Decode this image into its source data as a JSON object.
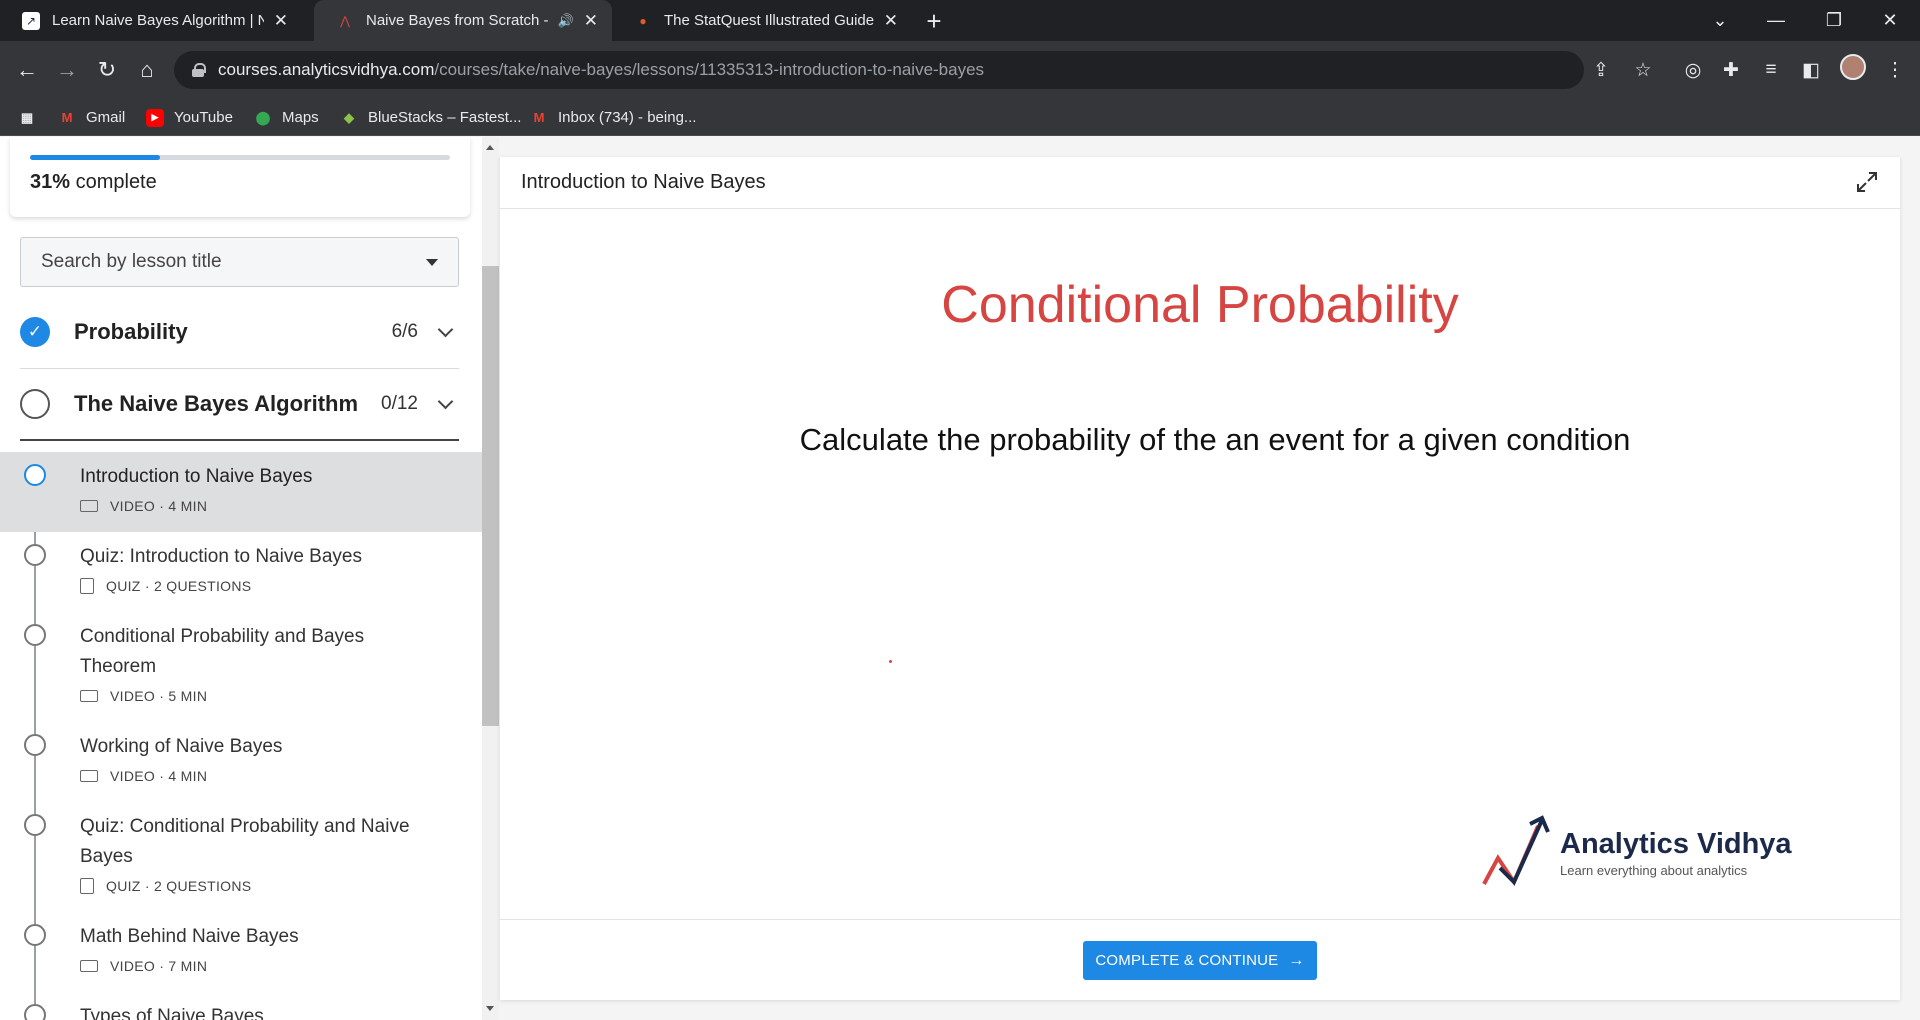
{
  "browser": {
    "tabs": [
      {
        "title": "Learn Naive Bayes Algorithm | N",
        "active": false
      },
      {
        "title": "Naive Bayes from Scratch - A",
        "active": true
      },
      {
        "title": "The StatQuest Illustrated Guide t",
        "active": false
      }
    ],
    "url_host": "courses.analyticsvidhya.com",
    "url_path": "/courses/take/naive-bayes/lessons/11335313-introduction-to-naive-bayes",
    "bookmarks": [
      {
        "label": "",
        "icon": "apps-icon"
      },
      {
        "label": "Gmail",
        "icon": "gmail-icon"
      },
      {
        "label": "YouTube",
        "icon": "youtube-icon"
      },
      {
        "label": "Maps",
        "icon": "maps-icon"
      },
      {
        "label": "BlueStacks – Fastest...",
        "icon": "bluestacks-icon"
      },
      {
        "label": "Inbox (734) - being...",
        "icon": "gmail-icon"
      }
    ]
  },
  "sidebar": {
    "progress_percent": 31,
    "progress_value": "31%",
    "progress_suffix": " complete",
    "search_placeholder": "Search by lesson title",
    "chapters": [
      {
        "title": "Probability",
        "count": "6/6",
        "completed": true
      },
      {
        "title": "The Naive Bayes Algorithm",
        "count": "0/12",
        "completed": false
      }
    ],
    "lessons": [
      {
        "title": "Introduction to Naive Bayes",
        "meta": "VIDEO · 4 MIN",
        "type": "video",
        "current": true
      },
      {
        "title": "Quiz: Introduction to Naive Bayes",
        "meta": "QUIZ · 2 QUESTIONS",
        "type": "quiz",
        "current": false
      },
      {
        "title": "Conditional Probability and Bayes Theorem",
        "meta": "VIDEO · 5 MIN",
        "type": "video",
        "current": false
      },
      {
        "title": "Working of Naive Bayes",
        "meta": "VIDEO · 4 MIN",
        "type": "video",
        "current": false
      },
      {
        "title": "Quiz: Conditional Probability and Naive Bayes",
        "meta": "QUIZ · 2 QUESTIONS",
        "type": "quiz",
        "current": false
      },
      {
        "title": "Math Behind Naive Bayes",
        "meta": "VIDEO · 7 MIN",
        "type": "video",
        "current": false
      },
      {
        "title": "Types of Naive Bayes",
        "meta": "",
        "type": "video",
        "current": false
      }
    ]
  },
  "main": {
    "lesson_title": "Introduction to Naive Bayes",
    "slide_title": "Conditional Probability",
    "slide_text": "Calculate the probability of the an event for a given condition",
    "logo_name": "Analytics Vidhya",
    "logo_tagline": "Learn everything about analytics",
    "cta_label": "COMPLETE & CONTINUE",
    "colors": {
      "accent": "#1e88e5",
      "slide_title": "#d64541"
    }
  }
}
